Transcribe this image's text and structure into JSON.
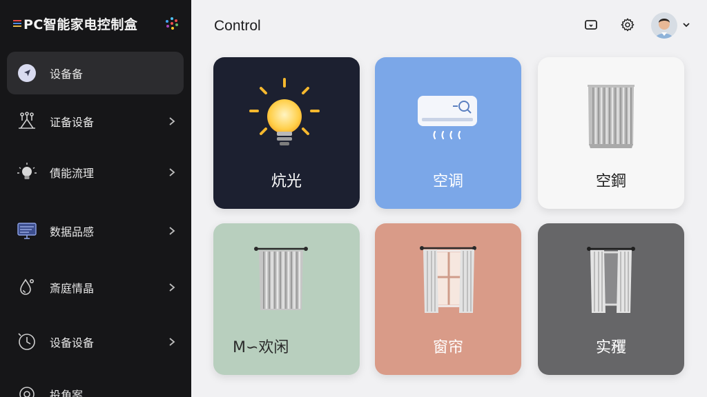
{
  "brand": {
    "title": "PC智能家电控制盒"
  },
  "sidebar": {
    "items": [
      {
        "label": "设备备",
        "icon": "navigation-arrow-icon",
        "active": true,
        "chevron": false
      },
      {
        "label": "证备设备",
        "icon": "network-nodes-icon",
        "active": false,
        "chevron": true
      },
      {
        "label": "債能流理",
        "icon": "lightbulb-icon",
        "active": false,
        "chevron": true
      },
      {
        "label": "数据品感",
        "icon": "monitor-icon",
        "active": false,
        "chevron": true
      },
      {
        "label": "斎庭情晶",
        "icon": "water-drop-icon",
        "active": false,
        "chevron": true
      },
      {
        "label": "设备设备",
        "icon": "clock-icon",
        "active": false,
        "chevron": true
      },
      {
        "label": "投角案",
        "icon": "settings-icon",
        "active": false,
        "chevron": false
      }
    ]
  },
  "header": {
    "title": "Control"
  },
  "cards": [
    {
      "label": "炕光",
      "icon": "lightbulb-icon",
      "bg": "#1c2030",
      "color": "#ffffff"
    },
    {
      "label": "空调",
      "icon": "air-conditioner-icon",
      "bg": "#7ba7e8",
      "color": "#ffffff"
    },
    {
      "label": "空鋼",
      "icon": "curtain-icon",
      "bg": "#f7f7f7",
      "color": "#1e1e1e"
    },
    {
      "label": "M∽欢闲",
      "icon": "curtain-rod-icon",
      "bg": "#b8cfbe",
      "color": "#2a2a2a"
    },
    {
      "label": "窗帘",
      "icon": "window-curtain-icon",
      "bg": "#d99b88",
      "color": "#ffffff"
    },
    {
      "label": "实矡",
      "icon": "window-curtain-icon",
      "bg": "#666668",
      "color": "#ffffff"
    }
  ],
  "colors": {
    "sidebar_bg": "#161618",
    "active_item_bg": "#2c2c2f",
    "page_bg": "#f1f1f3"
  }
}
